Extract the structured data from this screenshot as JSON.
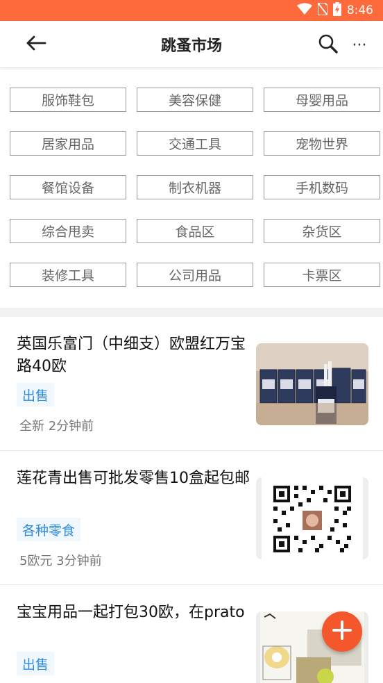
{
  "status_bar": {
    "time": "8:46",
    "icons": [
      "wifi-icon",
      "no-sim-icon",
      "battery-icon"
    ],
    "background_color": "#ff6a3d"
  },
  "app_bar": {
    "title": "跳蚤市场",
    "back_icon": "arrow-left-icon",
    "search_icon": "search-icon",
    "more_icon": "more-icon",
    "more_glyph": "···"
  },
  "categories": [
    "服饰鞋包",
    "美容保健",
    "母婴用品",
    "居家用品",
    "交通工具",
    "宠物世界",
    "餐馆设备",
    "制衣机器",
    "手机数码",
    "综合甩卖",
    "食品区",
    "杂货区",
    "装修工具",
    "公司用品",
    "卡票区"
  ],
  "listings": [
    {
      "title": "英国乐富门（中细支）欧盟红万宝路40欧",
      "tag": "出售",
      "meta": "全新 2分钟前",
      "thumb": "cigarettes-photo"
    },
    {
      "title": "莲花青出售可批发零售10盒起包邮",
      "tag": "各种零食",
      "meta": "5欧元 3分钟前",
      "thumb": "qr-code-image"
    },
    {
      "title": "宝宝用品一起打包30欧，在prato",
      "tag": "出售",
      "meta": "",
      "thumb": "baby-items-photo"
    }
  ],
  "fab": {
    "icon": "plus-icon",
    "color": "#f4572b"
  },
  "colors": {
    "accent": "#ff6a3d",
    "tag_text": "#2d8be0",
    "tag_bg": "#f0f7fd"
  }
}
